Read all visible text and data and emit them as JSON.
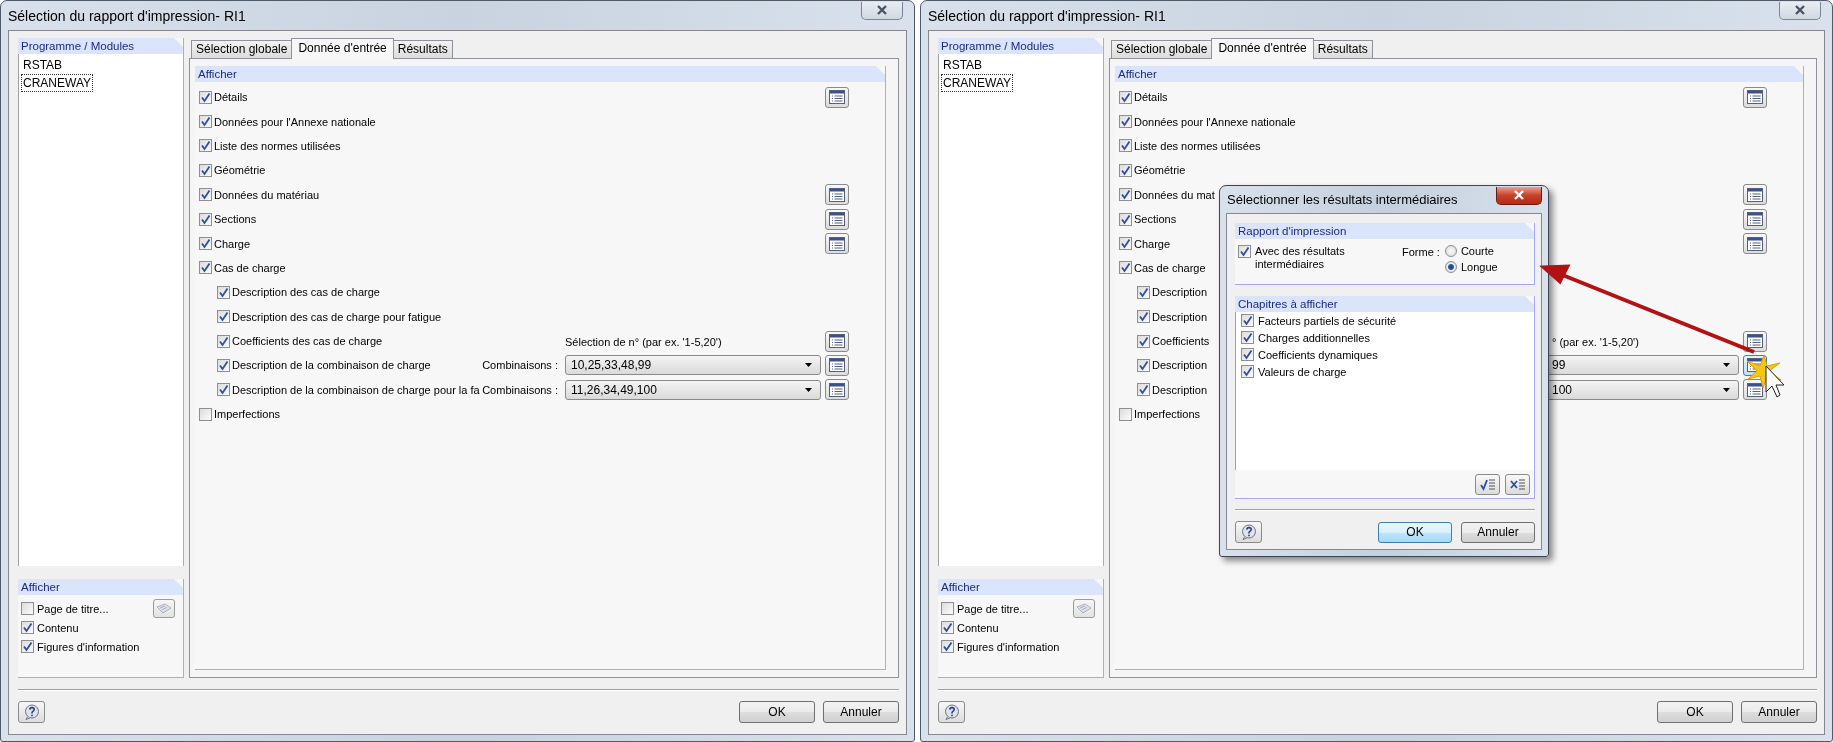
{
  "windows": [
    {
      "title": "Sélection du rapport d'impression- RI1",
      "modules": {
        "header": "Programme / Modules",
        "items": [
          {
            "label": "RSTAB",
            "focused": false
          },
          {
            "label": "CRANEWAY",
            "focused": true
          }
        ]
      },
      "display": {
        "header": "Afficher",
        "items": [
          {
            "label": "Page de titre...",
            "checked": false,
            "button": {
              "disabled": true
            }
          },
          {
            "label": "Contenu",
            "checked": true
          },
          {
            "label": "Figures d'information",
            "checked": true
          }
        ]
      },
      "tabs": [
        {
          "label": "Sélection globale",
          "selected": false
        },
        {
          "label": "Donnée d'entrée",
          "selected": true
        },
        {
          "label": "Résultats",
          "selected": false
        }
      ],
      "group": {
        "header": "Afficher",
        "rows": [
          {
            "label": "Détails",
            "checked": true,
            "button": {
              "hovered": false
            }
          },
          {
            "label": "Données pour l'Annexe nationale",
            "checked": true
          },
          {
            "label": "Liste des normes utilisées",
            "checked": true
          },
          {
            "label": "Géométrie",
            "checked": true
          },
          {
            "label": "Données du matériau",
            "checked": true,
            "button": {
              "hovered": false
            }
          },
          {
            "label": "Sections",
            "checked": true,
            "button": {
              "hovered": false
            }
          },
          {
            "label": "Charge",
            "checked": true,
            "button": {
              "hovered": false
            }
          },
          {
            "label": "Cas de charge",
            "checked": true,
            "children": [
              {
                "label": "Description des cas de charge",
                "checked": true
              },
              {
                "label": "Description des cas de charge pour fatigue",
                "checked": true
              },
              {
                "label": "Coefficients des cas de charge",
                "checked": true,
                "note": "Sélection de n° (par ex. '1-5,20')",
                "button": {
                  "hovered": false
                }
              },
              {
                "label": "Description de la combinaison de charge",
                "checked": true,
                "field_label": "Combinaisons :",
                "combo": "10,25,33,48,99",
                "button": {
                  "hovered": false
                }
              },
              {
                "label": "Description de la combinaison de charge pour la fa",
                "checked": true,
                "field_label": "Combinaisons :",
                "combo": "11,26,34,49,100",
                "button": {
                  "hovered": false
                }
              }
            ]
          },
          {
            "label": "Imperfections",
            "checked": false
          }
        ]
      },
      "buttons": [
        "OK",
        "Annuler"
      ]
    },
    {
      "title": "Sélection du rapport d'impression- RI1",
      "modules": {
        "header": "Programme / Modules",
        "items": [
          {
            "label": "RSTAB",
            "focused": false
          },
          {
            "label": "CRANEWAY",
            "focused": true
          }
        ]
      },
      "display": {
        "header": "Afficher",
        "items": [
          {
            "label": "Page de titre...",
            "checked": false,
            "button": {
              "disabled": true
            }
          },
          {
            "label": "Contenu",
            "checked": true
          },
          {
            "label": "Figures d'information",
            "checked": true
          }
        ]
      },
      "tabs": [
        {
          "label": "Sélection globale",
          "selected": false
        },
        {
          "label": "Donnée d'entrée",
          "selected": true
        },
        {
          "label": "Résultats",
          "selected": false
        }
      ],
      "group": {
        "header": "Afficher",
        "rows": [
          {
            "label": "Détails",
            "checked": true,
            "button": {
              "hovered": false
            }
          },
          {
            "label": "Données pour l'Annexe nationale",
            "checked": true
          },
          {
            "label": "Liste des normes utilisées",
            "checked": true
          },
          {
            "label": "Géométrie",
            "checked": true
          },
          {
            "label": "Données du mat",
            "checked": true,
            "button": {
              "hovered": false
            }
          },
          {
            "label": "Sections",
            "checked": true,
            "button": {
              "hovered": false
            }
          },
          {
            "label": "Charge",
            "checked": true,
            "button": {
              "hovered": false
            }
          },
          {
            "label": "Cas de charge",
            "checked": true,
            "children": [
              {
                "label": "Description",
                "checked": true
              },
              {
                "label": "Description",
                "checked": true
              },
              {
                "label": "Coefficients",
                "checked": true,
                "note": "° (par ex. '1-5,20')",
                "button": {
                  "hovered": false
                }
              },
              {
                "label": "Description",
                "checked": true,
                "combo": "99",
                "button": {
                  "hovered": true
                }
              },
              {
                "label": "Description",
                "checked": true,
                "combo": "100",
                "button": {
                  "hovered": false
                }
              }
            ]
          },
          {
            "label": "Imperfections",
            "checked": false
          }
        ]
      },
      "buttons": [
        "OK",
        "Annuler"
      ],
      "dialog": {
        "title": "Sélectionner les résultats intermédiaires",
        "report": {
          "header": "Rapport d'impression",
          "option": {
            "label": "Avec des résultats intermédiaires",
            "checked": true
          },
          "form_label": "Forme :",
          "choices": [
            {
              "label": "Courte",
              "selected": false
            },
            {
              "label": "Longue",
              "selected": true
            }
          ]
        },
        "chapters": {
          "header": "Chapitres à afficher",
          "items": [
            {
              "label": "Facteurs partiels de sécurité",
              "checked": true
            },
            {
              "label": "Charges additionnelles",
              "checked": true
            },
            {
              "label": "Coefficients dynamiques",
              "checked": true
            },
            {
              "label": "Valeurs de charge",
              "checked": true
            }
          ]
        },
        "buttons": [
          {
            "label": "OK",
            "default": true
          },
          {
            "label": "Annuler",
            "default": false
          }
        ]
      }
    }
  ]
}
